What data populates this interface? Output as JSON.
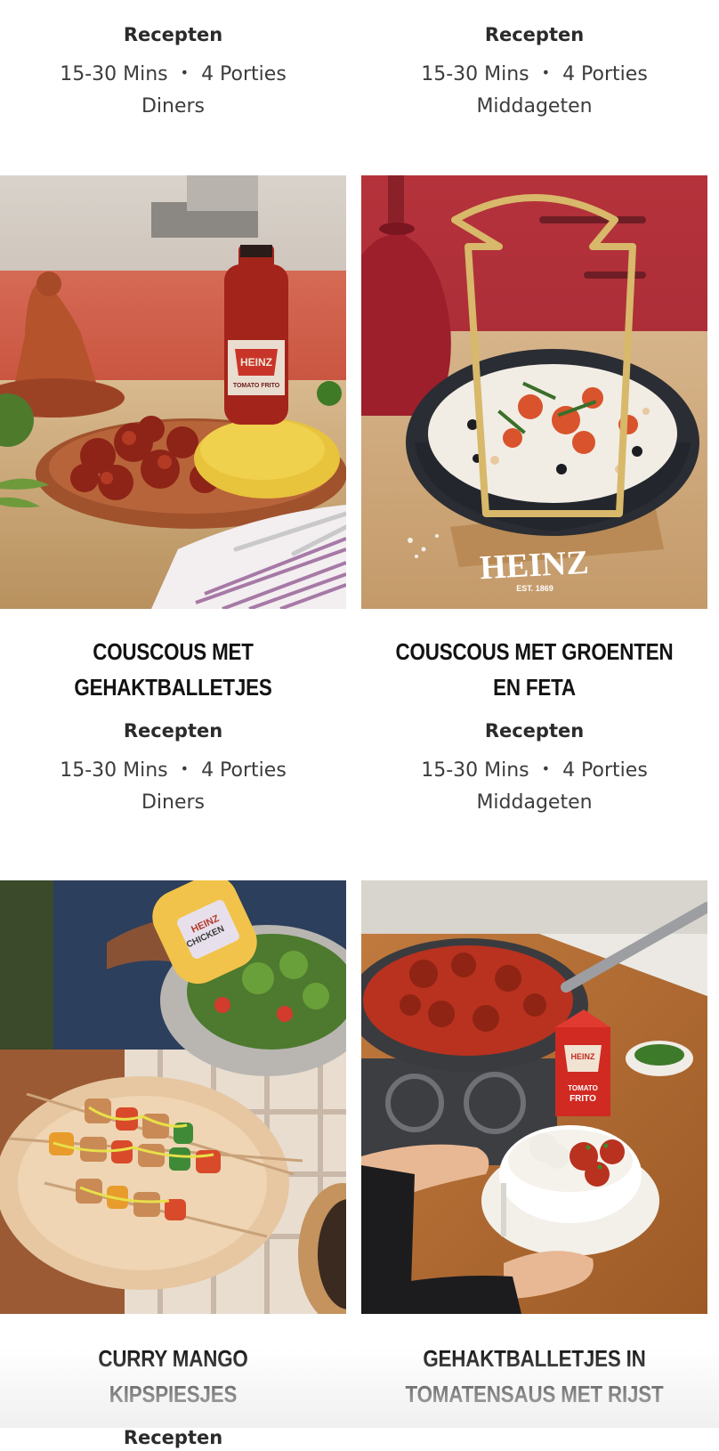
{
  "cards": [
    {
      "title": "",
      "category": "Recepten",
      "time": "15-30 Mins",
      "portions": "4 Porties",
      "course": "Diners"
    },
    {
      "title": "",
      "category": "Recepten",
      "time": "15-30 Mins",
      "portions": "4 Porties",
      "course": "Middageten"
    },
    {
      "title": "COUSCOUS MET GEHAKTBALLETJES",
      "category": "Recepten",
      "time": "15-30 Mins",
      "portions": "4 Porties",
      "course": "Diners",
      "image_label": "HEINZ TOMATO FRITO"
    },
    {
      "title": "COUSCOUS MET GROENTEN EN FETA",
      "category": "Recepten",
      "time": "15-30 Mins",
      "portions": "4 Porties",
      "course": "Middageten",
      "image_label": "HEINZ",
      "image_sublabel": "EST. 1869"
    },
    {
      "title": "CURRY MANGO KIPSPIESJES",
      "category": "Recepten",
      "image_label": "HEINZ CHICKEN"
    },
    {
      "title": "GEHAKTBALLETJES IN TOMATENSAUS MET RIJST",
      "image_label": "HEINZ TOMATO FRITO"
    }
  ],
  "meta_separator": "•",
  "colors": {
    "title": "#121212",
    "text": "#3c3c3c",
    "heinz_gold": "#d8b86a",
    "heinz_red": "#c8322b"
  }
}
